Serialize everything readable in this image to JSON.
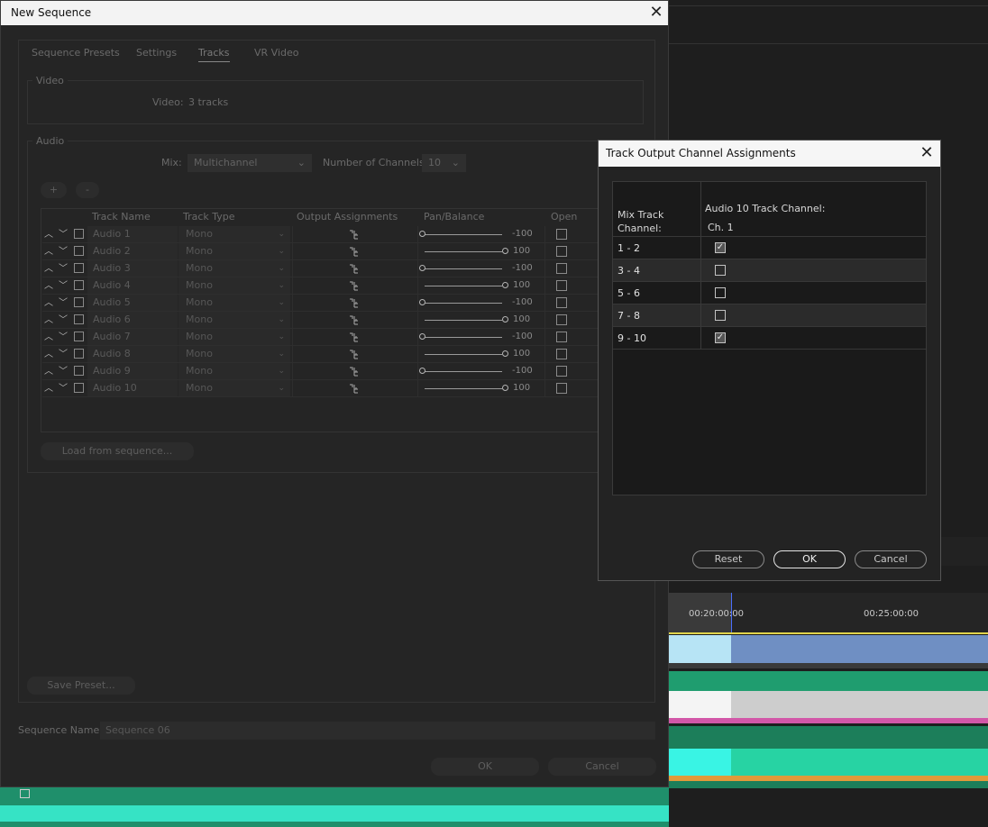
{
  "new_sequence": {
    "title": "New Sequence",
    "tabs": [
      "Sequence Presets",
      "Settings",
      "Tracks",
      "VR Video"
    ],
    "active_tab": "Tracks",
    "video": {
      "legend": "Video",
      "label": "Video:",
      "value": "3 tracks"
    },
    "audio": {
      "legend": "Audio",
      "mix_label": "Mix:",
      "mix_value": "Multichannel",
      "channels_label": "Number of Channels:",
      "channels_value": "10",
      "add_button": "+",
      "remove_button": "-",
      "columns": [
        "Track Name",
        "Track Type",
        "Output Assignments",
        "Pan/Balance",
        "Open"
      ],
      "tracks": [
        {
          "name": "Audio 1",
          "type": "Mono",
          "pan": "-100"
        },
        {
          "name": "Audio 2",
          "type": "Mono",
          "pan": "100"
        },
        {
          "name": "Audio 3",
          "type": "Mono",
          "pan": "-100"
        },
        {
          "name": "Audio 4",
          "type": "Mono",
          "pan": "100"
        },
        {
          "name": "Audio 5",
          "type": "Mono",
          "pan": "-100"
        },
        {
          "name": "Audio 6",
          "type": "Mono",
          "pan": "100"
        },
        {
          "name": "Audio 7",
          "type": "Mono",
          "pan": "-100"
        },
        {
          "name": "Audio 8",
          "type": "Mono",
          "pan": "100"
        },
        {
          "name": "Audio 9",
          "type": "Mono",
          "pan": "-100"
        },
        {
          "name": "Audio 10",
          "type": "Mono",
          "pan": "100"
        }
      ],
      "load_button": "Load from sequence..."
    },
    "save_preset_button": "Save Preset...",
    "sequence_name_label": "Sequence Name:",
    "sequence_name_value": "Sequence 06",
    "ok_button": "OK",
    "cancel_button": "Cancel"
  },
  "track_output_dialog": {
    "title": "Track Output Channel Assignments",
    "col1_header": "Mix Track Channel:",
    "col2_header": "Audio 10 Track Channel:",
    "col2_subheader": "Ch. 1",
    "rows": [
      {
        "label": "1 - 2",
        "checked": true
      },
      {
        "label": "3 - 4",
        "checked": false
      },
      {
        "label": "5 - 6",
        "checked": false
      },
      {
        "label": "7 - 8",
        "checked": false
      },
      {
        "label": "9 - 10",
        "checked": true
      }
    ],
    "reset_button": "Reset",
    "ok_button": "OK",
    "cancel_button": "Cancel"
  },
  "timeline": {
    "timecodes": [
      "00:20:00:00",
      "00:25:00:00"
    ]
  },
  "colors": {
    "video_clip": "#6f8fc3",
    "audio_clip": "#1f9d6f",
    "audio_bright": "#27d3a3",
    "audio_selected": "#cdcdcd",
    "label_pink": "#d257a8",
    "in_out_bar": "#e0d44c"
  }
}
